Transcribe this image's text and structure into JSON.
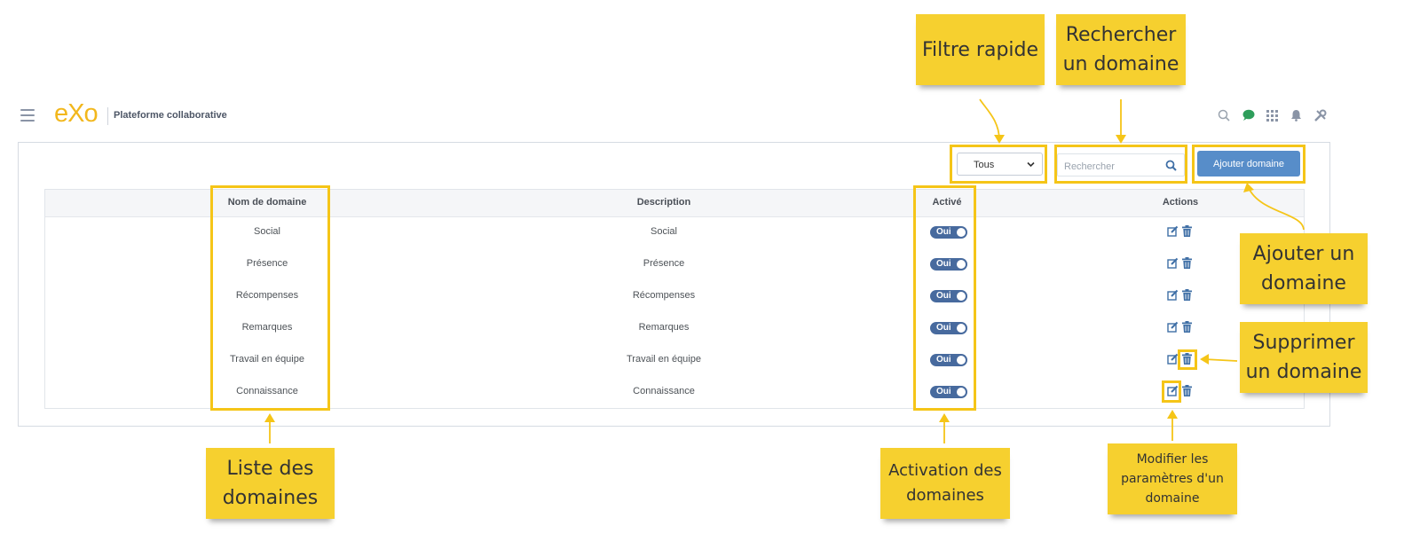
{
  "header": {
    "logo_text": "eXo",
    "platform_label": "Plateforme collaborative",
    "icons": [
      "menu-icon",
      "search-icon",
      "chat-icon",
      "apps-icon",
      "notification-icon",
      "admin-tools-icon"
    ]
  },
  "toolbar": {
    "filter_value": "Tous",
    "search_placeholder": "Rechercher",
    "add_label": "Ajouter domaine"
  },
  "table": {
    "columns": [
      "Nom de domaine",
      "Description",
      "Activé",
      "Actions"
    ],
    "rows": [
      {
        "name": "Social",
        "description": "Social",
        "active": "Oui"
      },
      {
        "name": "Présence",
        "description": "Présence",
        "active": "Oui"
      },
      {
        "name": "Récompenses",
        "description": "Récompenses",
        "active": "Oui"
      },
      {
        "name": "Remarques",
        "description": "Remarques",
        "active": "Oui"
      },
      {
        "name": "Travail en équipe",
        "description": "Travail en équipe",
        "active": "Oui"
      },
      {
        "name": "Connaissance",
        "description": "Connaissance",
        "active": "Oui"
      }
    ]
  },
  "annotations": {
    "filter": "Filtre rapide",
    "search": "Rechercher un domaine",
    "add": "Ajouter un domaine",
    "delete": "Supprimer un domaine",
    "edit": "Modifier les paramètres d'un domaine",
    "list": "Liste des domaines",
    "activation": "Activation des domaines"
  },
  "colors": {
    "accent_yellow": "#f6d02f",
    "button_blue": "#578dc9",
    "toggle_blue": "#476a9e",
    "logo_yellow": "#f2b71c"
  }
}
